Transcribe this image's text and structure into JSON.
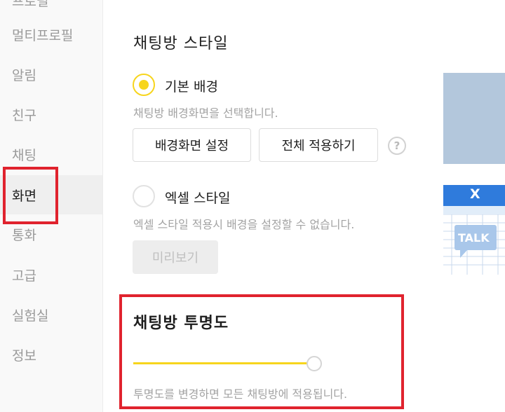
{
  "sidebar": {
    "items": [
      {
        "label": "프로필"
      },
      {
        "label": "멀티프로필"
      },
      {
        "label": "알림"
      },
      {
        "label": "친구"
      },
      {
        "label": "채팅"
      },
      {
        "label": "화면",
        "active": true
      },
      {
        "label": "통화"
      },
      {
        "label": "고급"
      },
      {
        "label": "실험실"
      },
      {
        "label": "정보"
      }
    ]
  },
  "chat_style": {
    "title": "채팅방 스타일",
    "basic": {
      "label": "기본 배경",
      "description": "채팅방 배경화면을 선택합니다.",
      "selected": true,
      "set_button": "배경화면 설정",
      "apply_all_button": "전체 적용하기",
      "help_glyph": "?"
    },
    "excel": {
      "label": "엑셀 스타일",
      "description": "엑셀 스타일 적용시 배경을 설정할 수 없습니다.",
      "selected": false,
      "preview_button": "미리보기"
    },
    "preview_excel": {
      "badge": "TALK",
      "logo": "X"
    }
  },
  "transparency": {
    "title": "채팅방 투명도",
    "level": 1.0,
    "description": "투명도를 변경하면 모든 채팅방에 적용됩니다."
  },
  "colors": {
    "accent": "#f7d51d",
    "highlight": "#e0232e",
    "preview_blue": "#b3c7dc",
    "excel_green": "#e1edf9"
  },
  "icons": {
    "help": "question-circle-icon",
    "excel_logo": "excel-x-icon",
    "talk_bubble": "talk-bubble-icon"
  }
}
